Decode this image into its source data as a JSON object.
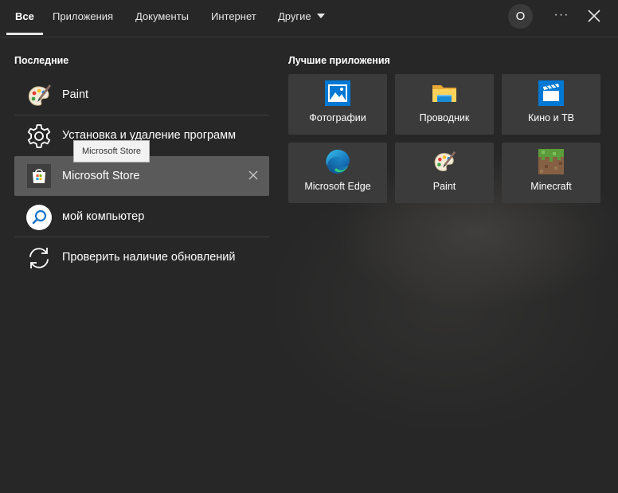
{
  "tabs": [
    {
      "label": "Все"
    },
    {
      "label": "Приложения"
    },
    {
      "label": "Документы"
    },
    {
      "label": "Интернет"
    },
    {
      "label": "Другие"
    }
  ],
  "account": {
    "initial": "O"
  },
  "more_label": "···",
  "recent": {
    "title": "Последние",
    "items": [
      {
        "label": "Paint",
        "icon": "paint-icon"
      },
      {
        "label": "Установка и удаление программ",
        "icon": "gear-icon"
      },
      {
        "label": "Microsoft Store",
        "icon": "store-icon"
      },
      {
        "label": "мой компьютер",
        "icon": "search-icon"
      },
      {
        "label": "Проверить наличие обновлений",
        "icon": "sync-icon"
      }
    ],
    "tooltip": "Microsoft Store"
  },
  "top_apps": {
    "title": "Лучшие приложения",
    "items": [
      {
        "label": "Фотографии",
        "icon": "photos-icon"
      },
      {
        "label": "Проводник",
        "icon": "file-explorer-icon"
      },
      {
        "label": "Кино и ТВ",
        "icon": "movies-tv-icon"
      },
      {
        "label": "Microsoft Edge",
        "icon": "edge-icon"
      },
      {
        "label": "Paint",
        "icon": "paint-icon"
      },
      {
        "label": "Minecraft",
        "icon": "minecraft-icon"
      }
    ]
  },
  "colors": {
    "background": "#272727",
    "tile": "#3b3b3b",
    "selected_row": "#5a5a5a",
    "accent_blue": "#0078d4"
  }
}
